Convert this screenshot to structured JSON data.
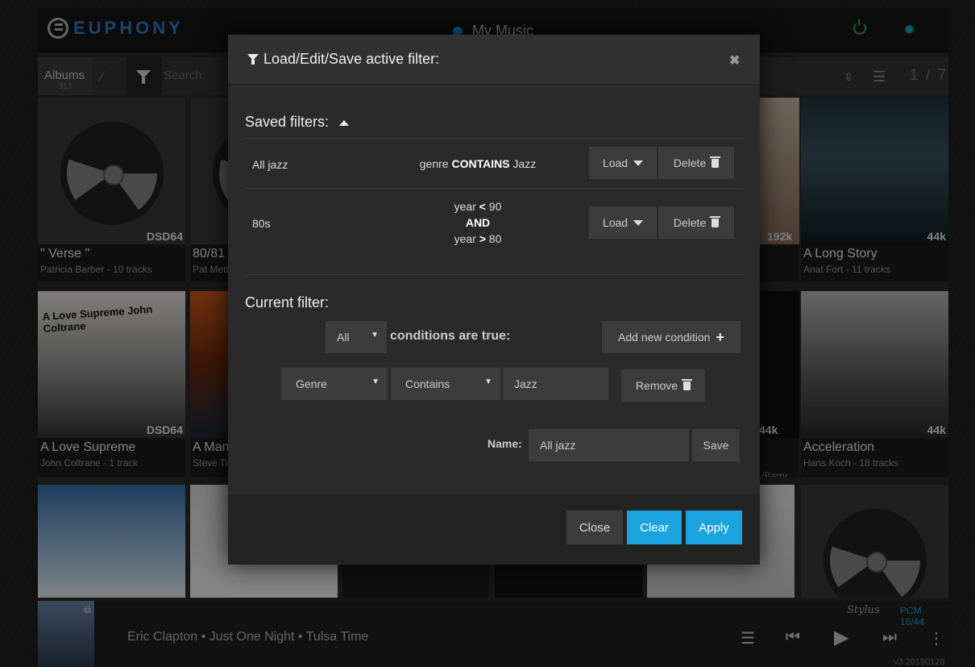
{
  "header": {
    "logo_text": "EUPHONY",
    "location_label": "My Music"
  },
  "toolbar": {
    "albums_label": "Albums",
    "albums_count": "313",
    "search_placeholder": "Search",
    "page_indicator": "1 / 7"
  },
  "tiles": [
    {
      "title": "\" Verse \"",
      "subtitle": "Patricia Barber - 10 tracks",
      "badge": "DSD64"
    },
    {
      "title": "80/81 [",
      "subtitle": "Pat Meth",
      "badge": ""
    },
    {
      "title": "A Long Story",
      "subtitle": "Anat Fort - 11 tracks",
      "badge": "44k"
    },
    {
      "title": "A Love Supreme",
      "subtitle": "John Coltrane - 1 track",
      "badge": "DSD64",
      "cover_text": "A Love Supreme John Coltrane"
    },
    {
      "title": "A Man",
      "subtitle": "Steve Ti",
      "badge": ""
    },
    {
      "title": "Acceleration",
      "subtitle": "Hans Koch - 18 tracks",
      "badge": "44k"
    }
  ],
  "partial_badges": {
    "b192": "192k",
    "b44a": "44k",
    "barry": "/Barry ..."
  },
  "player": {
    "now_playing": "Eric Clapton • Just One Night • Tulsa Time",
    "stylus_label": "Stylus",
    "format": "PCM 16/44",
    "version": "v3.20190128"
  },
  "modal": {
    "title": "Load/Edit/Save active filter:",
    "saved_filters_label": "Saved filters:",
    "saved_filters": [
      {
        "name": "All jazz",
        "expr_lines": [
          {
            "pre": "genre ",
            "op": "CONTAINS",
            "post": " Jazz"
          }
        ],
        "load_label": "Load",
        "delete_label": "Delete"
      },
      {
        "name": "80s",
        "expr_lines": [
          {
            "pre": "year ",
            "op": "<",
            "post": " 90"
          },
          {
            "pre": "",
            "op": "AND",
            "post": ""
          },
          {
            "pre": "year ",
            "op": ">",
            "post": " 80"
          }
        ],
        "load_label": "Load",
        "delete_label": "Delete"
      }
    ],
    "current_filter_label": "Current filter:",
    "match_mode": "All",
    "conditions_text": "conditions are true:",
    "add_condition_label": "Add new condition",
    "condition": {
      "field": "Genre",
      "operator": "Contains",
      "value": "Jazz",
      "remove_label": "Remove"
    },
    "name_label": "Name:",
    "name_value": "All jazz",
    "save_label": "Save",
    "close_label": "Close",
    "clear_label": "Clear",
    "apply_label": "Apply",
    "accent_color": "#1aa3dc"
  }
}
